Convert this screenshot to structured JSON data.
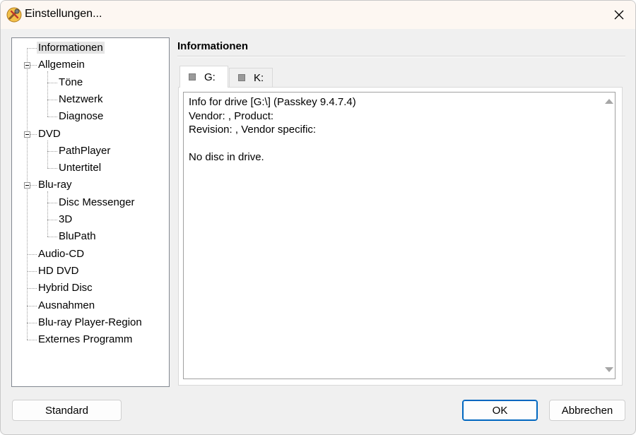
{
  "window": {
    "title": "Einstellungen...",
    "app_icon": "tools-app-icon",
    "close_icon": "close-icon"
  },
  "tree": {
    "items": [
      {
        "label": "Informationen",
        "level": 0,
        "expandable": false,
        "selected": true
      },
      {
        "label": "Allgemein",
        "level": 0,
        "expandable": true
      },
      {
        "label": "Töne",
        "level": 1
      },
      {
        "label": "Netzwerk",
        "level": 1
      },
      {
        "label": "Diagnose",
        "level": 1
      },
      {
        "label": "DVD",
        "level": 0,
        "expandable": true
      },
      {
        "label": "PathPlayer",
        "level": 1
      },
      {
        "label": "Untertitel",
        "level": 1
      },
      {
        "label": "Blu-ray",
        "level": 0,
        "expandable": true
      },
      {
        "label": "Disc Messenger",
        "level": 1
      },
      {
        "label": "3D",
        "level": 1
      },
      {
        "label": "BluPath",
        "level": 1
      },
      {
        "label": "Audio-CD",
        "level": 0
      },
      {
        "label": "HD DVD",
        "level": 0
      },
      {
        "label": "Hybrid Disc",
        "level": 0
      },
      {
        "label": "Ausnahmen",
        "level": 0
      },
      {
        "label": "Blu-ray Player-Region",
        "level": 0
      },
      {
        "label": "Externes Programm",
        "level": 0
      }
    ]
  },
  "main": {
    "section_title": "Informationen",
    "tabs": [
      {
        "label": "G:",
        "active": true,
        "icon": "drive-icon"
      },
      {
        "label": "K:",
        "active": false,
        "icon": "drive-icon"
      }
    ],
    "info_lines": [
      "Info for drive [G:\\] (Passkey 9.4.7.4)",
      "Vendor: , Product:",
      "Revision: , Vendor specific:",
      "",
      "No disc in drive."
    ]
  },
  "buttons": {
    "standard": "Standard",
    "ok": "OK",
    "cancel": "Abbrechen"
  }
}
